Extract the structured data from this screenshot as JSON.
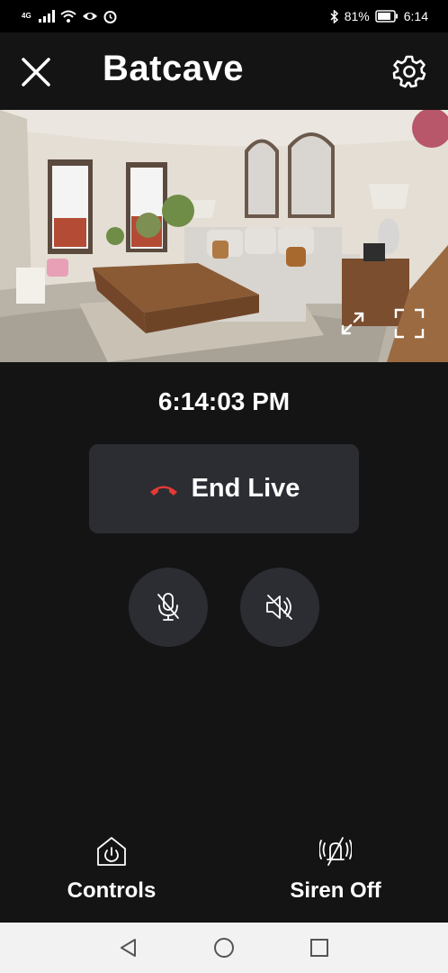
{
  "status_bar": {
    "network": "4G",
    "battery_percent": "81%",
    "time": "6:14",
    "icons": [
      "signal-icon",
      "wifi-icon",
      "eye-icon",
      "alarm-icon",
      "bluetooth-icon",
      "battery-icon"
    ]
  },
  "header": {
    "title": "Batcave",
    "close_icon": "close-icon",
    "settings_icon": "gear-icon"
  },
  "camera": {
    "controls": [
      "expand-icon",
      "fullscreen-icon"
    ]
  },
  "live": {
    "timestamp": "6:14:03 PM",
    "end_live_label": "End Live",
    "end_live_icon": "hangup-icon",
    "end_live_icon_color": "#e53935",
    "mic_icon": "mic-muted-icon",
    "speaker_icon": "speaker-muted-icon"
  },
  "bottom_actions": [
    {
      "label": "Controls",
      "icon": "home-power-icon"
    },
    {
      "label": "Siren Off",
      "icon": "siren-off-icon"
    }
  ],
  "nav_bar": {
    "buttons": [
      "back-icon",
      "home-icon",
      "recents-icon"
    ]
  },
  "colors": {
    "background": "#141414",
    "button_bg": "#2b2d33",
    "text": "#ffffff"
  }
}
